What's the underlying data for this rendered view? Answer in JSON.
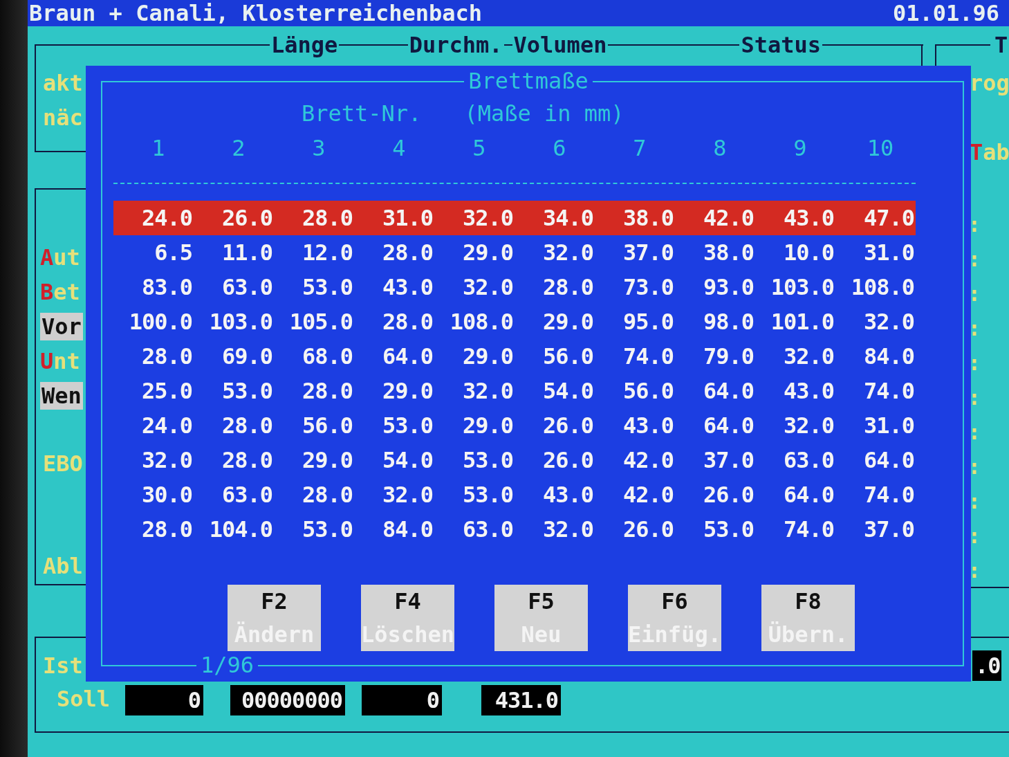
{
  "title_bar": {
    "company": "Braun + Canali, Klosterreichenbach",
    "date": "01.01.96"
  },
  "columns_header": [
    "Länge",
    "Durchm.",
    "Volumen",
    "Status",
    "T"
  ],
  "left_top_labels": [
    "akt",
    "näc"
  ],
  "left_menu": [
    {
      "hotkey": "A",
      "rest": "ut",
      "highlighted": false
    },
    {
      "hotkey": "B",
      "rest": "et",
      "highlighted": false
    },
    {
      "rest": "Vor",
      "highlighted": true
    },
    {
      "hotkey": "U",
      "rest": "nt",
      "highlighted": false
    },
    {
      "rest": "Wen",
      "highlighted": true
    }
  ],
  "left_bottom_labels": [
    "EBO",
    "Abl"
  ],
  "right_labels": [
    {
      "rest": "rog"
    },
    {
      "hotkey": "T",
      "rest": "ab"
    }
  ],
  "right_markers": [
    ":",
    ":",
    ":",
    ":",
    ":",
    ":",
    ":",
    ":",
    ":",
    ":",
    ":"
  ],
  "dialog": {
    "title": "Brettmaße",
    "subtitle_left": "Brett-Nr.",
    "subtitle_right": "(Maße in mm)",
    "columns": [
      "1",
      "2",
      "3",
      "4",
      "5",
      "6",
      "7",
      "8",
      "9",
      "10"
    ],
    "rows": [
      {
        "selected": true,
        "cells": [
          "24.0",
          "26.0",
          "28.0",
          "31.0",
          "32.0",
          "34.0",
          "38.0",
          "42.0",
          "43.0",
          "47.0"
        ]
      },
      {
        "selected": false,
        "cells": [
          "6.5",
          "11.0",
          "12.0",
          "28.0",
          "29.0",
          "32.0",
          "37.0",
          "38.0",
          "10.0",
          "31.0"
        ]
      },
      {
        "selected": false,
        "cells": [
          "83.0",
          "63.0",
          "53.0",
          "43.0",
          "32.0",
          "28.0",
          "73.0",
          "93.0",
          "103.0",
          "108.0"
        ]
      },
      {
        "selected": false,
        "cells": [
          "100.0",
          "103.0",
          "105.0",
          "28.0",
          "108.0",
          "29.0",
          "95.0",
          "98.0",
          "101.0",
          "32.0"
        ]
      },
      {
        "selected": false,
        "cells": [
          "28.0",
          "69.0",
          "68.0",
          "64.0",
          "29.0",
          "56.0",
          "74.0",
          "79.0",
          "32.0",
          "84.0"
        ]
      },
      {
        "selected": false,
        "cells": [
          "25.0",
          "53.0",
          "28.0",
          "29.0",
          "32.0",
          "54.0",
          "56.0",
          "64.0",
          "43.0",
          "74.0"
        ]
      },
      {
        "selected": false,
        "cells": [
          "24.0",
          "28.0",
          "56.0",
          "53.0",
          "29.0",
          "26.0",
          "43.0",
          "64.0",
          "32.0",
          "31.0"
        ]
      },
      {
        "selected": false,
        "cells": [
          "32.0",
          "28.0",
          "29.0",
          "54.0",
          "53.0",
          "26.0",
          "42.0",
          "37.0",
          "63.0",
          "64.0"
        ]
      },
      {
        "selected": false,
        "cells": [
          "30.0",
          "63.0",
          "28.0",
          "32.0",
          "53.0",
          "43.0",
          "42.0",
          "26.0",
          "64.0",
          "74.0"
        ]
      },
      {
        "selected": false,
        "cells": [
          "28.0",
          "104.0",
          "53.0",
          "84.0",
          "63.0",
          "32.0",
          "26.0",
          "53.0",
          "74.0",
          "37.0"
        ]
      }
    ],
    "buttons": [
      {
        "key": "F2",
        "label": "Ändern"
      },
      {
        "key": "F4",
        "label": "Löschen"
      },
      {
        "key": "F5",
        "label": "Neu"
      },
      {
        "key": "F6",
        "label": "Einfüg."
      },
      {
        "key": "F8",
        "label": "Übern."
      }
    ],
    "page": "1/96"
  },
  "totals": {
    "ist_label": "Ist",
    "soll_label": "Soll",
    "soll_fields": [
      "0",
      "00000000",
      "0",
      "431.0"
    ],
    "ist_field": ".0"
  }
}
